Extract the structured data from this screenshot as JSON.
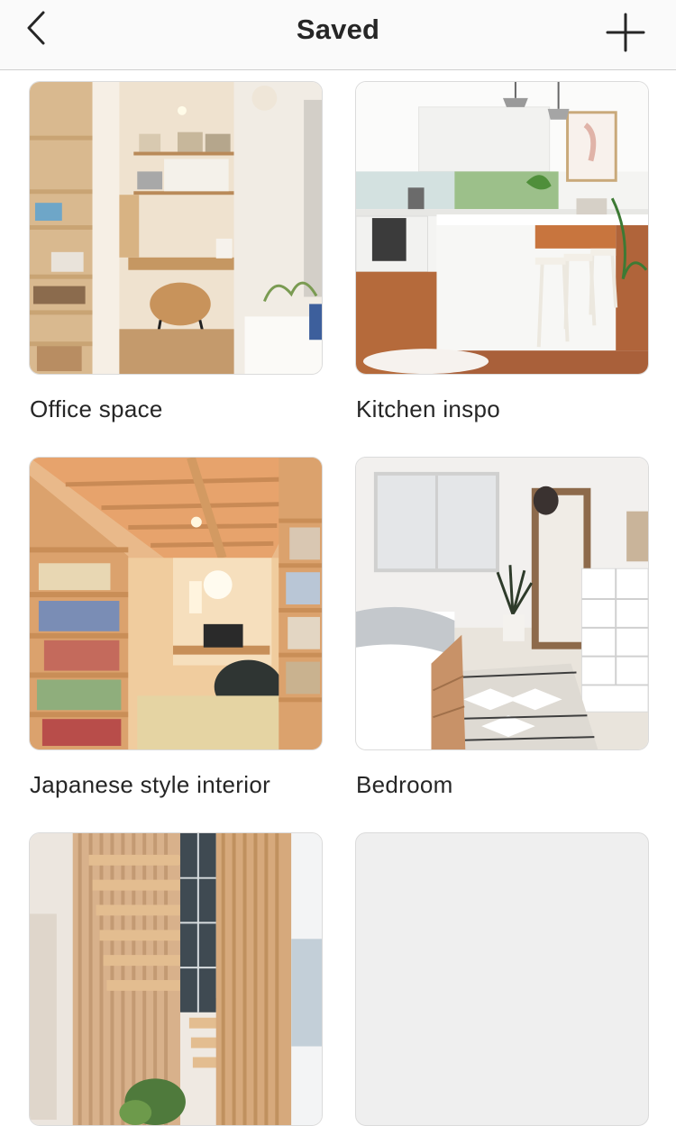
{
  "header": {
    "title": "Saved",
    "back_icon": "chevron-left-icon",
    "add_icon": "plus-icon",
    "background": "#fafafa"
  },
  "collections": [
    {
      "name": "Office space"
    },
    {
      "name": "Kitchen inspo"
    },
    {
      "name": "Japanese style interior"
    },
    {
      "name": "Bedroom"
    },
    {
      "name": ""
    },
    {
      "name": ""
    }
  ],
  "colors": {
    "text": "#262626",
    "divider": "#dbdbdb",
    "empty_tile": "#efefef"
  }
}
